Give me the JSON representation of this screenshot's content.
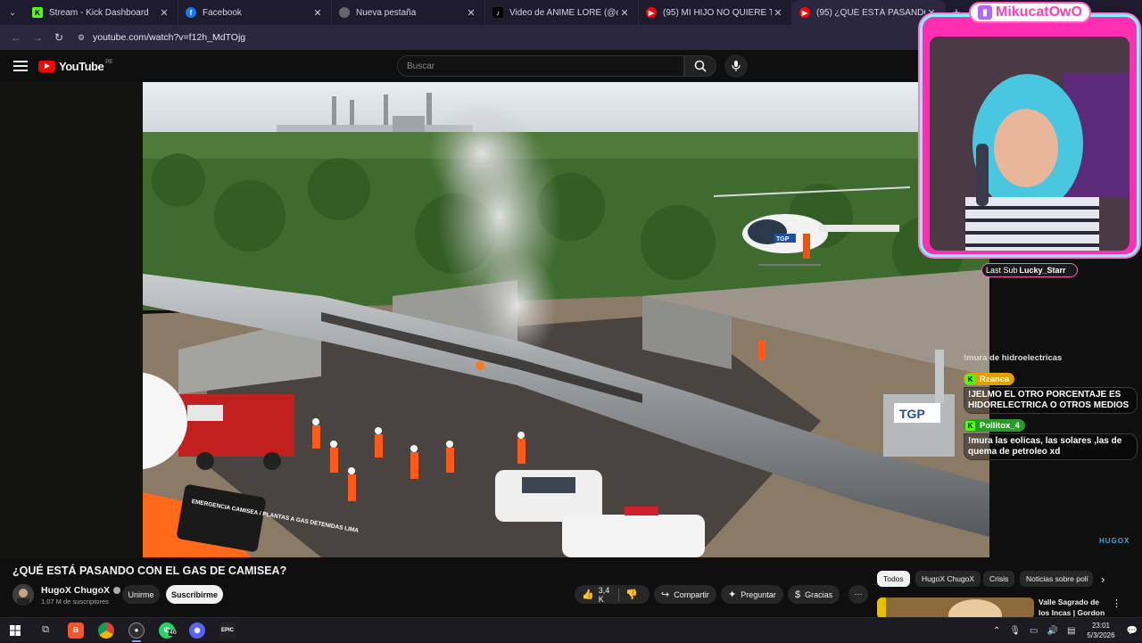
{
  "browser": {
    "tabs": [
      {
        "title": "Stream - Kick Dashboard",
        "icon": "kick-icon",
        "color": "#53fc18"
      },
      {
        "title": "Facebook",
        "icon": "facebook-icon",
        "color": "#1877f2"
      },
      {
        "title": "Nueva pestaña",
        "icon": "globe-icon",
        "color": "#888888"
      },
      {
        "title": "Video de ANIME LORE (@china",
        "icon": "tiktok-icon",
        "color": "#000000"
      },
      {
        "title": "(95) MI HIJO NO QUIERE TRAB",
        "icon": "youtube-icon",
        "color": "#ff0000"
      },
      {
        "title": "(95) ¿QUÉ ESTÁ PASANDO CON",
        "icon": "youtube-icon",
        "color": "#ff0000",
        "active": true
      }
    ],
    "url": "youtube.com/watch?v=f12h_MdTOjg"
  },
  "youtube": {
    "logo_text": "YouTube",
    "country_code": "PE",
    "search_placeholder": "Buscar"
  },
  "stream_overlay": {
    "streamer_name": "MikucatOwO",
    "last_sub_label": "Last Sub",
    "last_sub_name": "Lucky_Starr",
    "chat": [
      {
        "user": "",
        "text": "!mura de hidroelectricas",
        "color": "#000000"
      },
      {
        "user": "Rzanca",
        "text": "!JELMO EL OTRO PORCENTAJE ES HIDORELECTRICA O OTROS MEDIOS",
        "color": "#e0a000"
      },
      {
        "user": "Pollitox_4",
        "text": "!mura las eolicas, las solares ,las de quema de petroleo xd",
        "color": "#2a9a2a"
      }
    ],
    "watermark": "HUGOX"
  },
  "video_scene": {
    "sign_text": "EMERGENCIA CAMISEA / PLANTAS A GAS DETENIDAS LIMA",
    "pipeline_brand": "TGP",
    "helicopter_brand": "TGP"
  },
  "video": {
    "title": "¿QUÉ ESTÁ PASANDO CON EL GAS DE CAMISEA?",
    "channel_name": "HugoX ChugoX",
    "subscribers": "1,07 M de suscriptores",
    "join_label": "Unirme",
    "subscribe_label": "Suscribirme",
    "likes": "3,4 K",
    "share_label": "Compartir",
    "ask_label": "Preguntar",
    "thanks_label": "Gracias"
  },
  "chips": [
    "Todos",
    "HugoX ChugoX",
    "Crisis",
    "Noticias sobre polí"
  ],
  "recommended": {
    "title": "Valle Sagrado de los Incas | Gordon ..."
  },
  "taskbar": {
    "whatsapp_badge": "46",
    "time": "23:01",
    "date": "5/3/2026"
  }
}
